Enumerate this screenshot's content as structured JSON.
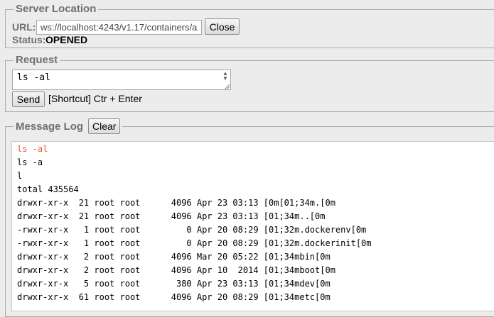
{
  "server": {
    "legend": "Server Location",
    "url_label": "URL:",
    "url_value": "ws://localhost:4243/v1.17/containers/a",
    "close_label": "Close",
    "status_label": "Status:",
    "status_value": "OPENED"
  },
  "request": {
    "legend": "Request",
    "command": "ls -al",
    "send_label": "Send",
    "shortcut_hint": "[Shortcut] Ctr + Enter"
  },
  "log": {
    "legend": "Message Log",
    "clear_label": "Clear",
    "lines": [
      "ls -al",
      "ls -a",
      "l",
      "total 435564",
      "drwxr-xr-x  21 root root      4096 Apr 23 03:13 [0m[01;34m.[0m",
      "drwxr-xr-x  21 root root      4096 Apr 23 03:13 [01;34m..[0m",
      "-rwxr-xr-x   1 root root         0 Apr 20 08:29 [01;32m.dockerenv[0m",
      "-rwxr-xr-x   1 root root         0 Apr 20 08:29 [01;32m.dockerinit[0m",
      "drwxr-xr-x   2 root root      4096 Mar 20 05:22 [01;34mbin[0m",
      "drwxr-xr-x   2 root root      4096 Apr 10  2014 [01;34mboot[0m",
      "drwxr-xr-x   5 root root       380 Apr 23 03:13 [01;34mdev[0m",
      "drwxr-xr-x  61 root root      4096 Apr 20 08:29 [01;34metc[0m"
    ]
  },
  "colors": {
    "sent_command": "#e0623a",
    "legend_text": "#6f6f6f"
  }
}
